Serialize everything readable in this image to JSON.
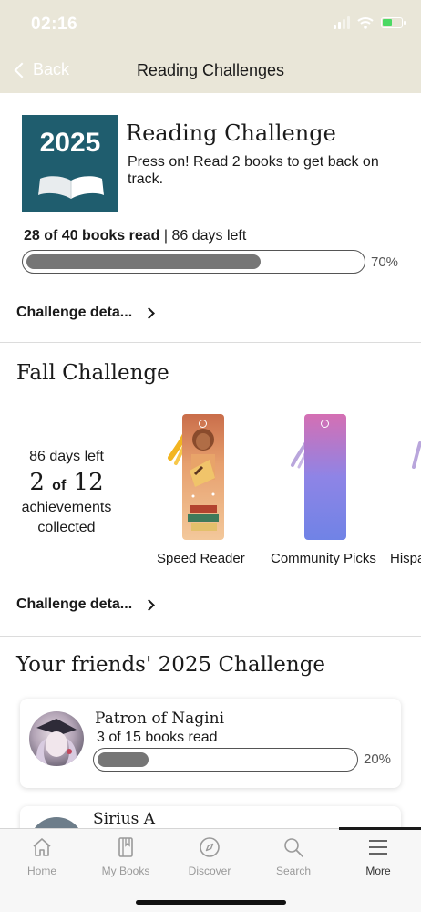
{
  "status": {
    "time": "02:16"
  },
  "nav": {
    "back_label": "Back",
    "title": "Reading Challenges"
  },
  "reading_challenge": {
    "year": "2025",
    "title": "Reading Challenge",
    "subtitle": "Press on! Read 2 books to get back on track.",
    "books_read": "28 of 40 books read",
    "separator": "|",
    "days_left": "86 days left",
    "progress": 0.7,
    "progress_label": "70%",
    "details_label": "Challenge deta..."
  },
  "fall_challenge": {
    "title": "Fall Challenge",
    "days_left": "86 days left",
    "collected": "2",
    "of_word": "of",
    "total": "12",
    "achievements_label": "achievements collected",
    "badges": [
      {
        "label": "Speed Reader",
        "icon": "speed-reader-bookmark"
      },
      {
        "label": "Community Picks",
        "icon": "community-picks-bookmark"
      },
      {
        "label": "Hispa"
      }
    ],
    "details_label": "Challenge deta..."
  },
  "friends": {
    "title": "Your friends' 2025 Challenge",
    "items": [
      {
        "name": "Patron of Nagini",
        "books_read": "3 of 15 books read",
        "progress": 0.2,
        "progress_label": "20%"
      },
      {
        "name": "Sirius A"
      }
    ]
  },
  "tabs": [
    {
      "label": "Home",
      "icon": "home-icon"
    },
    {
      "label": "My Books",
      "icon": "book-icon"
    },
    {
      "label": "Discover",
      "icon": "compass-icon"
    },
    {
      "label": "Search",
      "icon": "search-icon"
    },
    {
      "label": "More",
      "icon": "menu-icon",
      "active": true
    }
  ],
  "colors": {
    "header_bg": "#e9e6d8",
    "cover_bg": "#1f5d6e",
    "progress_fill": "#767676"
  }
}
